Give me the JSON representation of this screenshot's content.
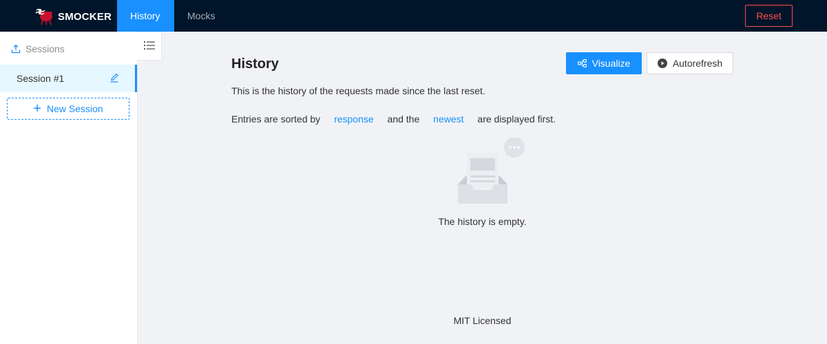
{
  "header": {
    "brand": "SMOCKER",
    "nav": [
      {
        "label": "History",
        "active": true
      },
      {
        "label": "Mocks",
        "active": false
      }
    ],
    "reset_label": "Reset"
  },
  "sidebar": {
    "sessions_label": "Sessions",
    "sessions": [
      {
        "label": "Session #1",
        "selected": true
      }
    ],
    "new_session_label": "New Session"
  },
  "main": {
    "title": "History",
    "visualize_label": "Visualize",
    "autorefresh_label": "Autorefresh",
    "description": "This is the history of the requests made since the last reset.",
    "sort": {
      "prefix": "Entries are sorted by",
      "sort_field": "response",
      "middle": "and the",
      "order": "newest",
      "suffix": "are displayed first."
    },
    "empty_text": "The history is empty."
  },
  "footer": {
    "text": "MIT Licensed"
  },
  "colors": {
    "header_bg": "#001529",
    "primary": "#1890ff",
    "danger": "#ff4d4f",
    "page_bg": "#f0f2f5"
  },
  "icons": {
    "logo": "smocker-logo",
    "sessions": "upload-icon",
    "edit": "edit-icon",
    "add": "plus-icon",
    "menu": "menu-unfold-icon",
    "visualize": "branches-icon",
    "autorefresh": "play-circle-icon",
    "empty": "empty-inbox-icon"
  }
}
